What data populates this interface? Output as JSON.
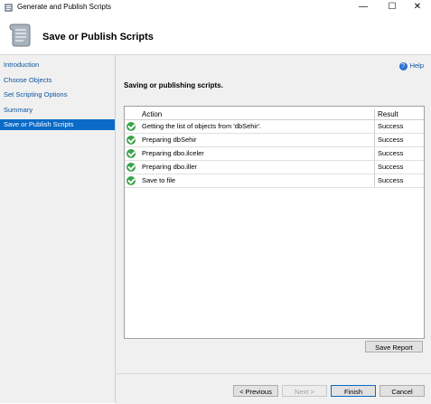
{
  "window": {
    "title": "Generate and Publish Scripts",
    "min_label": "—",
    "max_label": "☐",
    "close_label": "✕"
  },
  "header": {
    "title": "Save or Publish Scripts",
    "icon": "script-scroll-icon"
  },
  "nav": {
    "items": [
      {
        "label": "Introduction",
        "active": false
      },
      {
        "label": "Choose Objects",
        "active": false
      },
      {
        "label": "Set Scripting Options",
        "active": false
      },
      {
        "label": "Summary",
        "active": false
      },
      {
        "label": "Save or Publish Scripts",
        "active": true
      }
    ]
  },
  "help": {
    "label": "Help",
    "icon": "help-icon"
  },
  "main": {
    "section_title": "Saving or publishing scripts.",
    "columns": {
      "action": "Action",
      "result": "Result"
    },
    "rows": [
      {
        "action": "Getting the list of objects from 'dbSehir'.",
        "result": "Success",
        "status_icon": "success-check-icon"
      },
      {
        "action": "Preparing dbSehir",
        "result": "Success",
        "status_icon": "success-check-icon"
      },
      {
        "action": "Preparing dbo.ilceler",
        "result": "Success",
        "status_icon": "success-check-icon"
      },
      {
        "action": "Preparing dbo.iller",
        "result": "Success",
        "status_icon": "success-check-icon"
      },
      {
        "action": "Save to file",
        "result": "Success",
        "status_icon": "success-check-icon"
      }
    ],
    "save_report_label": "Save Report"
  },
  "footer": {
    "previous_label": "< Previous",
    "next_label": "Next >",
    "finish_label": "Finish",
    "cancel_label": "Cancel"
  },
  "colors": {
    "accent": "#0a6bc7",
    "link": "#0b56a0",
    "success": "#3aa34a"
  }
}
